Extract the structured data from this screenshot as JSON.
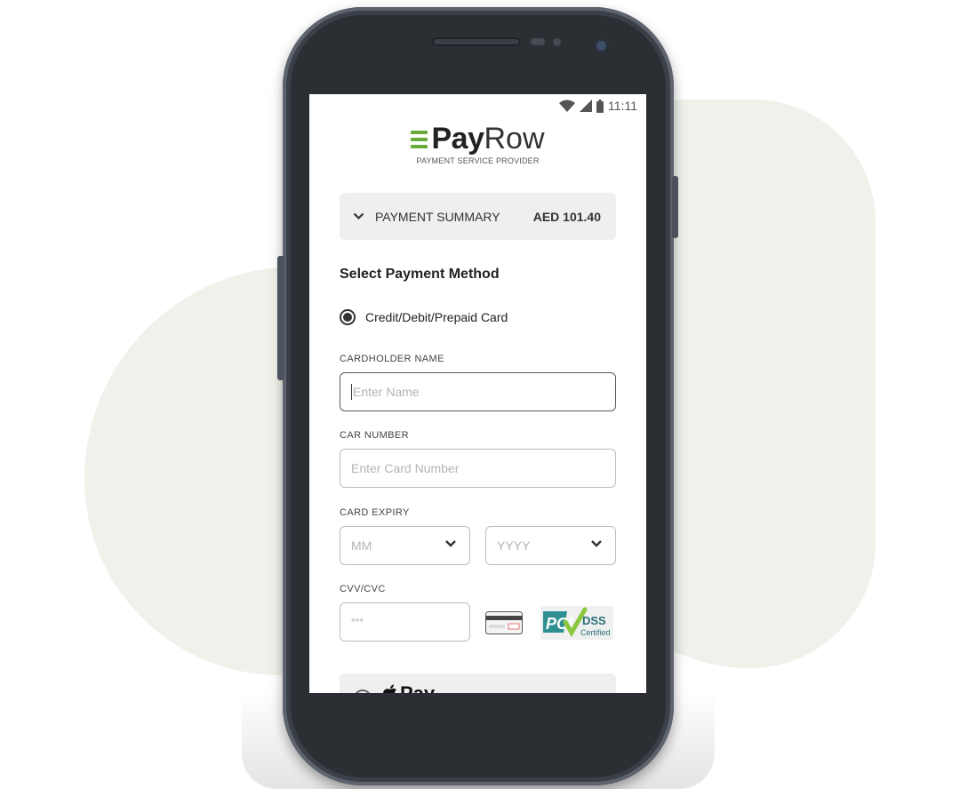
{
  "status_bar": {
    "time": "11:11"
  },
  "brand": {
    "name_bold": "Pay",
    "name_light": "Row",
    "tagline": "PAYMENT SERVICE PROVIDER",
    "accent_color": "#6aaa3c"
  },
  "summary": {
    "label": "PAYMENT SUMMARY",
    "amount": "AED 101.40"
  },
  "section_title": "Select Payment Method",
  "method": {
    "label": "Credit/Debit/Prepaid Card",
    "selected": true
  },
  "fields": {
    "name": {
      "label": "CARDHOLDER NAME",
      "placeholder": "Enter Name"
    },
    "card": {
      "label": "CAR NUMBER",
      "placeholder": "Enter Card Number"
    },
    "expiry": {
      "label": "CARD EXPIRY",
      "month_placeholder": "MM",
      "year_placeholder": "YYYY"
    },
    "cvv": {
      "label": "CVV/CVC",
      "placeholder": "***"
    }
  },
  "badges": {
    "pci_top": "DSS",
    "pci_bottom": "Certified"
  },
  "apple_pay": {
    "label": "Pay"
  }
}
